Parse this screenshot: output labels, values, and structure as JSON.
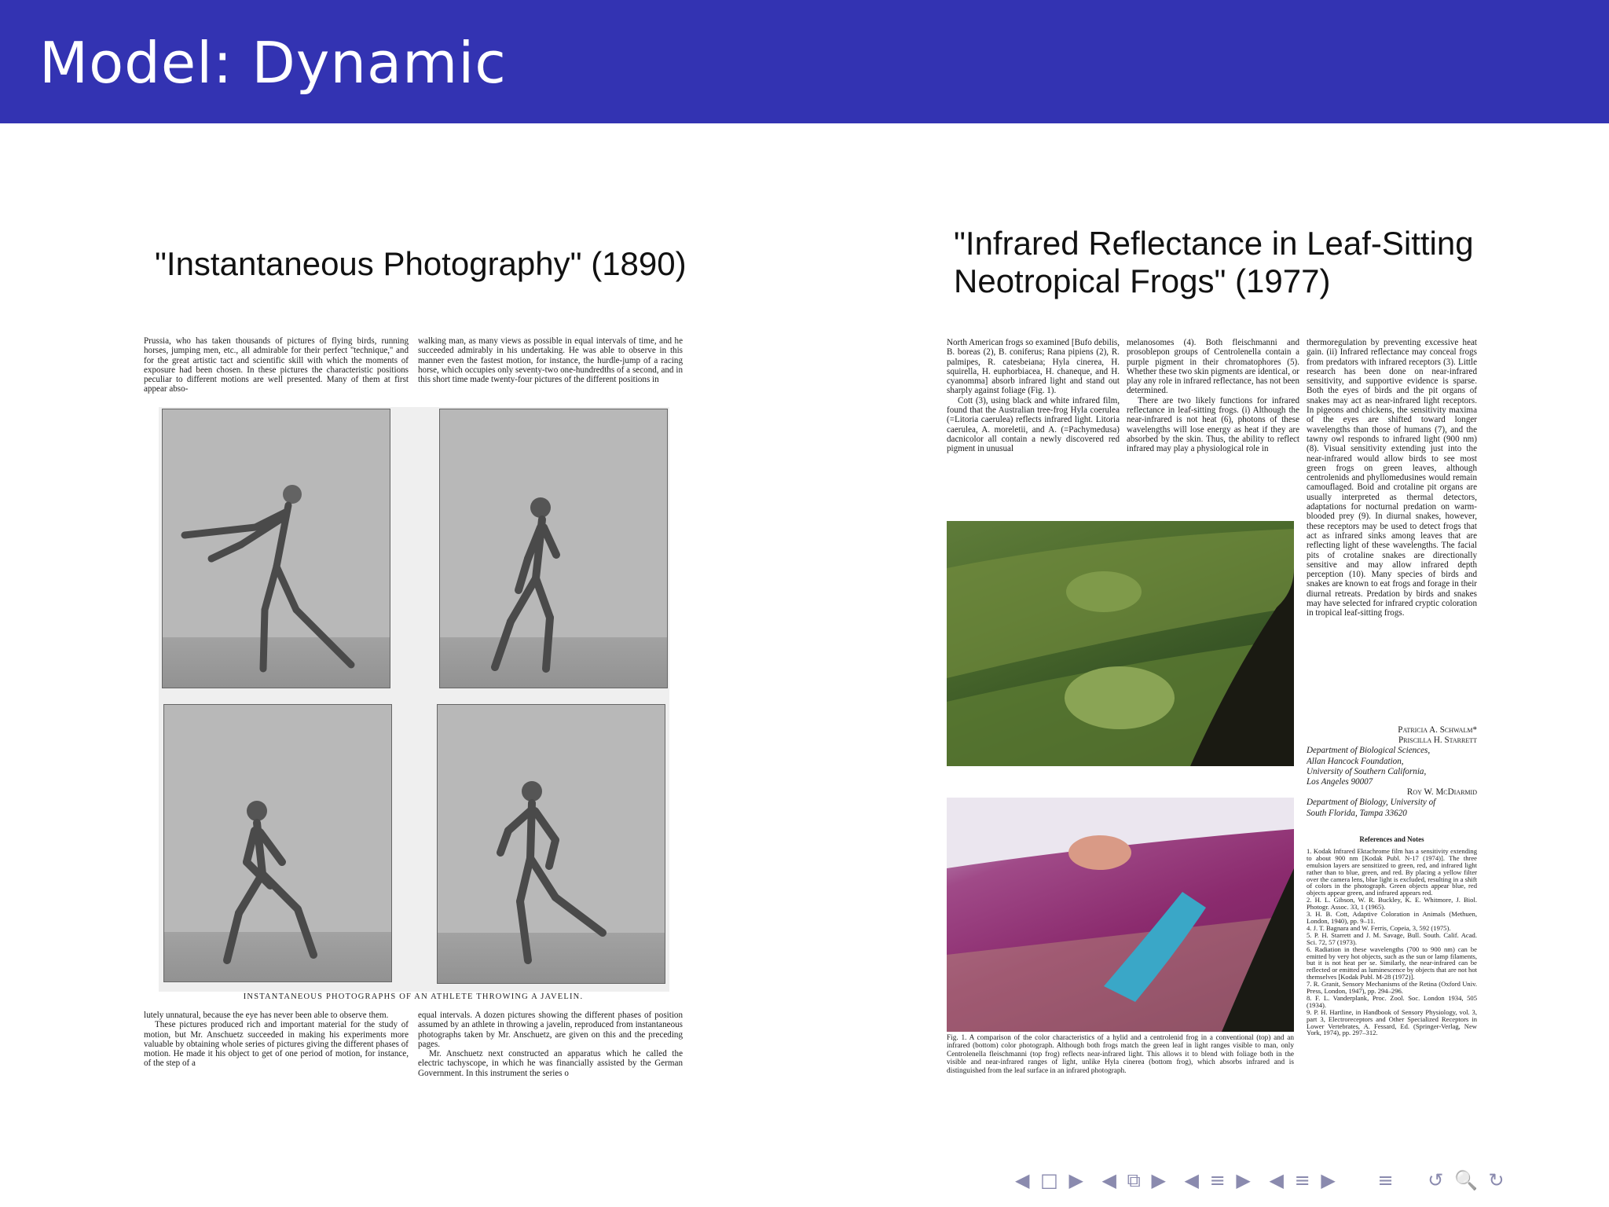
{
  "frame": {
    "title": "Model: Dynamic"
  },
  "left": {
    "heading": "\"Instantaneous Photography\" (1890)",
    "col1": "Prussia, who has taken thousands of pictures of flying birds, running horses, jumping men, etc., all admirable for their perfect ''technique,'' and for the great artistic tact and scientific skill with which the moments of exposure had been chosen. In these pictures the characteristic positions peculiar to different motions are well presented. Many of them at first appear abso-",
    "col2": "walking man, as many views as possible in equal intervals of time, and he succeeded admirably in his undertaking. He was able to observe in this manner even the fastest motion, for instance, the hurdle-jump of a racing horse, which occupies only seventy-two one-hundredths of a second, and in this short time made twenty-four pictures of the different positions in",
    "caption": "INSTANTANEOUS PHOTOGRAPHS OF AN ATHLETE THROWING A JAVELIN.",
    "col3": [
      "lutely unnatural, because the eye has never been able to observe them.",
      "These pictures produced rich and important material for the study of motion, but Mr. Anschuetz succeeded in making his experiments more valuable by obtaining whole series of pictures giving the different phases of motion. He made it his object to get of one period of motion, for instance, of the step of a"
    ],
    "col4": [
      "equal intervals. A dozen pictures showing the different phases of position assumed by an athlete in throwing a javelin, reproduced from instantaneous photographs taken by Mr. Anschuetz, are given on this and the preceding pages.",
      "Mr. Anschuetz next constructed an apparatus which he called the electric tachyscope, in which he was financially assisted by the German Government. In this instrument the series o"
    ]
  },
  "right": {
    "heading_line1": "\"Infrared Reflectance in Leaf-Sitting",
    "heading_line2": "Neotropical Frogs\" (1977)",
    "col1": [
      "North American frogs so examined [Bufo debilis, B. boreas (2), B. coniferus; Rana pipiens (2), R. palmipes, R. catesbeiana; Hyla cinerea, H. squirella, H. euphorbiacea, H. chaneque, and H. cyanomma] absorb infrared light and stand out sharply against foliage (Fig. 1).",
      "Cott (3), using black and white infrared film, found that the Australian tree-frog Hyla coerulea (=Litoria caerulea) reflects infrared light. Litoria caerulea, A. moreletii, and A. (=Pachymedusa) dacnicolor all contain a newly discovered red pigment in unusual"
    ],
    "col2": [
      "melanosomes (4). Both fleischmanni and prosoblepon groups of Centrolenella contain a purple pigment in their chromatophores (5). Whether these two skin pigments are identical, or play any role in infrared reflectance, has not been determined.",
      "There are two likely functions for infrared reflectance in leaf-sitting frogs. (i) Although the near-infrared is not heat (6), photons of these wavelengths will lose energy as heat if they are absorbed by the skin. Thus, the ability to reflect infrared may play a physiological role in"
    ],
    "col3": "thermoregulation by preventing excessive heat gain. (ii) Infrared reflectance may conceal frogs from predators with infrared receptors (3). Little research has been done on near-infrared sensitivity, and supportive evidence is sparse. Both the eyes of birds and the pit organs of snakes may act as near-infrared light receptors. In pigeons and chickens, the sensitivity maxima of the eyes are shifted toward longer wavelengths than those of humans (7), and the tawny owl responds to infrared light (900 nm) (8). Visual sensitivity extending just into the near-infrared would allow birds to see most green frogs on green leaves, although centrolenids and phyllomedusines would remain camouflaged. Boid and crotaline pit organs are usually interpreted as thermal detectors, adaptations for nocturnal predation on warm-blooded prey (9). In diurnal snakes, however, these receptors may be used to detect frogs that act as infrared sinks among leaves that are reflecting light of these wavelengths. The facial pits of crotaline snakes are directionally sensitive and may allow infrared depth perception (10). Many species of birds and snakes are known to eat frogs and forage in their diurnal retreats. Predation by birds and snakes may have selected for infrared cryptic coloration in tropical leaf-sitting frogs.",
    "authors": [
      "Patricia A. Schwalm*",
      "Priscilla H. Starrett"
    ],
    "affil1": [
      "Department of Biological Sciences,",
      "Allan Hancock Foundation,",
      "University of Southern California,",
      "Los Angeles 90007"
    ],
    "author3": "Roy W. McDiarmid",
    "affil2": [
      "Department of Biology, University of",
      "South Florida, Tampa 33620"
    ],
    "refs_heading": "References and Notes",
    "refs": [
      "1. Kodak Infrared Ektachrome film has a sensitivity extending to about 900 nm [Kodak Publ. N-17 (1974)]. The three emulsion layers are sensitized to green, red, and infrared light rather than to blue, green, and red. By placing a yellow filter over the camera lens, blue light is excluded, resulting in a shift of colors in the photograph. Green objects appear blue, red objects appear green, and infrared appears red.",
      "2. H. L. Gibson, W. R. Buckley, K. E. Whitmore, J. Biol. Photogr. Assoc. 33, 1 (1965).",
      "3. H. B. Cott, Adaptive Coloration in Animals (Methuen, London, 1940), pp. 9–11.",
      "4. J. T. Bagnara and W. Ferris, Copeia, 3, 592 (1975).",
      "5. P. H. Starrett and J. M. Savage, Bull. South. Calif. Acad. Sci. 72, 57 (1973).",
      "6. Radiation in these wavelengths (700 to 900 nm) can be emitted by very hot objects, such as the sun or lamp filaments, but it is not heat per se. Similarly, the near-infrared can be reflected or emitted as luminescence by objects that are not hot themselves [Kodak Publ. M-28 (1972)].",
      "7. R. Granit, Sensory Mechanisms of the Retina (Oxford Univ. Press, London, 1947), pp. 294–296.",
      "8. F. L. Vanderplank, Proc. Zool. Soc. London 1934, 505 (1934).",
      "9. P. H. Hartline, in Handbook of Sensory Physiology, vol. 3, part 3, Electroreceptors and Other Specialized Receptors in Lower Vertebrates, A. Fessard, Ed. (Springer-Verlag, New York, 1974), pp. 297–312."
    ],
    "fig_caption": "Fig. 1. A comparison of the color characteristics of a hylid and a centrolenid frog in a conventional (top) and an infrared (bottom) color photograph. Although both frogs match the green leaf in light ranges visible to man, only Centrolenella fleischmanni (top frog) reflects near-infrared light. This allows it to blend with foliage both in the visible and near-infrared ranges of light, unlike Hyla cinerea (bottom frog), which absorbs infrared and is distinguished from the leaf surface in an infrared photograph."
  },
  "nav": [
    "◀",
    "□",
    "▶",
    "◀",
    "⧉",
    "▶",
    "◀",
    "≡",
    "▶",
    "◀",
    "≡",
    "▶",
    "≡",
    "↺",
    "🔍",
    "↻"
  ],
  "colors": {
    "title_bar": "#3333b2",
    "nav": "#8a8aae"
  }
}
